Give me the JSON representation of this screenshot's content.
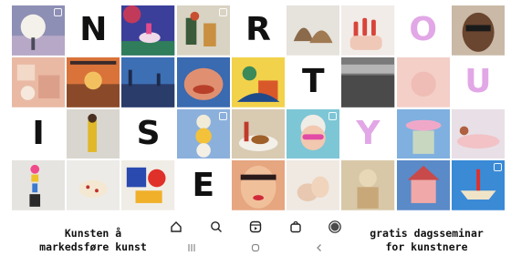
{
  "letters": [
    "N",
    "R",
    "O",
    "T",
    "U",
    "I",
    "S",
    "Y",
    "E"
  ],
  "letter_colors": {
    "black": "#111111",
    "pink": "#e2a7e6"
  },
  "captions": {
    "left": [
      "Kunsten å",
      "markedsføre kunst"
    ],
    "right": [
      "gratis dagsseminar",
      "for kunstnere"
    ]
  },
  "nav_icons": [
    "home-icon",
    "search-icon",
    "reels-icon",
    "shop-icon",
    "profile-avatar"
  ],
  "system_nav_icons": [
    "recent-apps-icon",
    "home-circle-icon",
    "back-icon"
  ]
}
